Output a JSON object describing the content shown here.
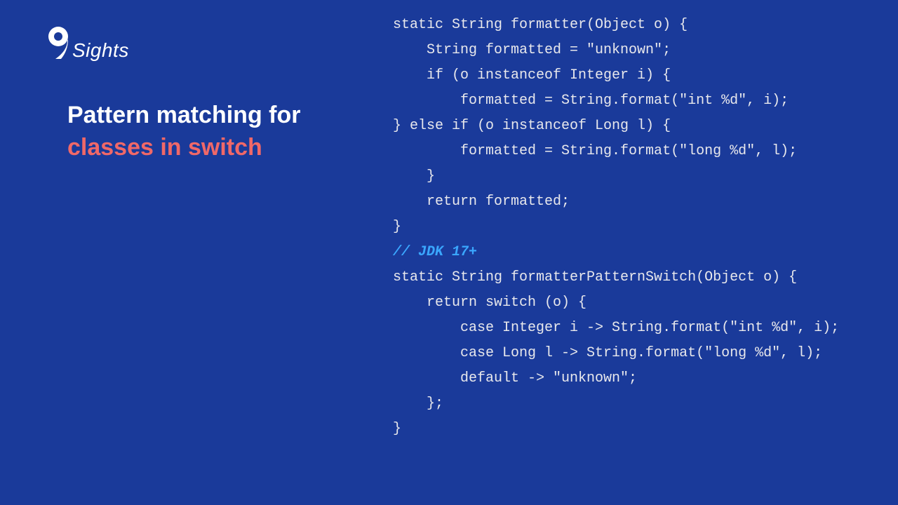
{
  "logo": {
    "text": "Sights"
  },
  "headline": {
    "line1": "Pattern matching for",
    "line2": "classes in switch"
  },
  "code": {
    "l1": "static String formatter(Object o) {",
    "l2": "    String formatted = \"unknown\";",
    "l3": "    if (o instanceof Integer i) {",
    "l4": "        formatted = String.format(\"int %d\", i);",
    "l5": "} else if (o instanceof Long l) {",
    "l6": "        formatted = String.format(\"long %d\", l);",
    "l7": "    }",
    "l8": "    return formatted;",
    "l9": "}",
    "comment": "// JDK 17+",
    "l10": "static String formatterPatternSwitch(Object o) {",
    "l11": "    return switch (o) {",
    "l12": "        case Integer i -> String.format(\"int %d\", i);",
    "l13": "        case Long l -> String.format(\"long %d\", l);",
    "l14": "        default -> \"unknown\";",
    "l15": "    };",
    "l16": "}"
  }
}
